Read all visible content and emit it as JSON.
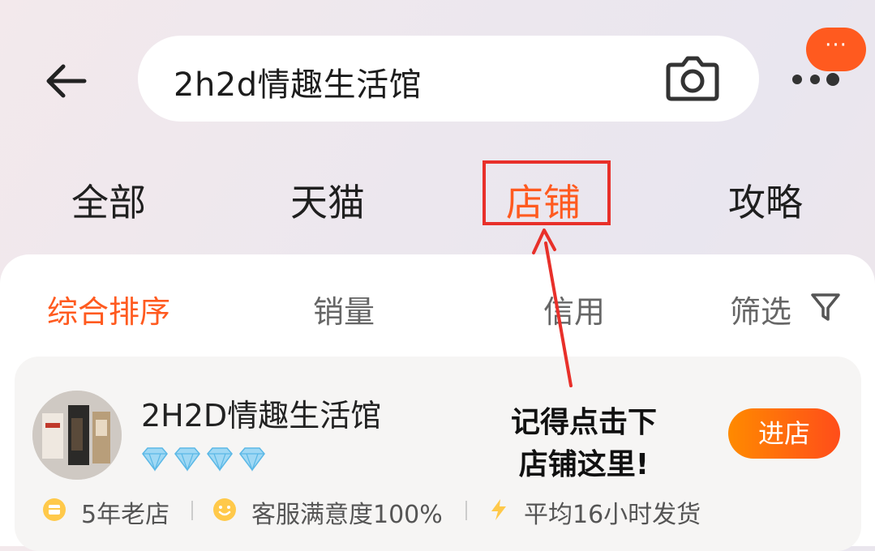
{
  "header": {
    "search_value": "2h2d情趣生活馆",
    "badge": "···"
  },
  "tabs": [
    {
      "label": "全部"
    },
    {
      "label": "天猫"
    },
    {
      "label": "店铺"
    },
    {
      "label": "攻略"
    }
  ],
  "sort_bar": {
    "items": [
      "综合排序",
      "销量",
      "信用",
      "筛选"
    ]
  },
  "shop": {
    "name": "2H2D情趣生活馆",
    "enter_label": "进店",
    "age": "5年老店",
    "satisfaction": "客服满意度100%",
    "shipping": "平均16小时发货",
    "diamond_count": 4
  },
  "annotation": {
    "line1": "记得点击下",
    "line2": "店铺这里!"
  },
  "colors": {
    "accent": "#ff5a1f",
    "highlight_box": "#e8302a"
  }
}
